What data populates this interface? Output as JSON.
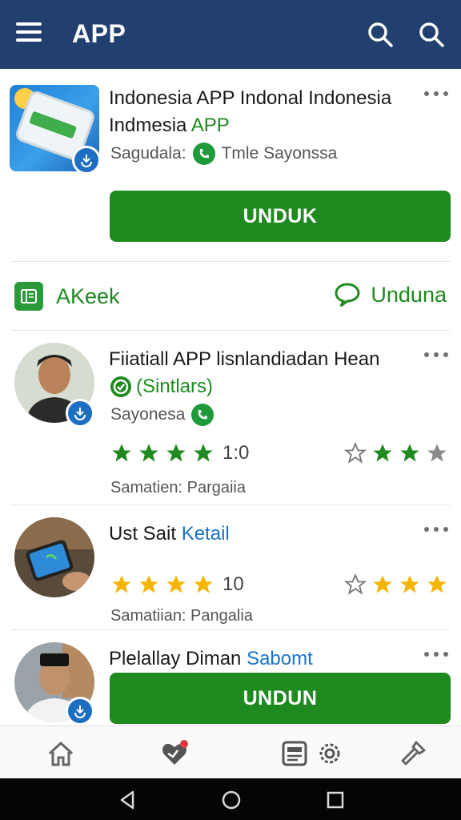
{
  "appbar": {
    "title": "APP",
    "menu_icon": "menu-icon",
    "search_icons": [
      "search-icon",
      "search-icon"
    ]
  },
  "featured": {
    "title_part1": "Indonesia APP Indonal Indonesia",
    "title_part2a": "Indmesia ",
    "title_part2b": "APP",
    "sub_label": "Sagudala:",
    "sub_value": "Tmle Sayonssa",
    "button_label": "UNDUK"
  },
  "section": {
    "left_label": "AKeek",
    "right_label": "Unduna"
  },
  "items": [
    {
      "title": "Fiiatiall APP lisnlandiadan Hean",
      "tag": "(Sintlars)",
      "sub": "Sayonesa",
      "rating_value": "1:0",
      "meta": "Samatien: Pargaiia"
    },
    {
      "title_a": "Ust Sait ",
      "title_b": "Ketail",
      "rating_value": "10",
      "meta": "Samatiian: Pangalia"
    },
    {
      "title_a": "Plelallay Diman ",
      "title_b": "Sabomt",
      "button_label": "UNDUN"
    }
  ],
  "colors": {
    "appbar": "#22406f",
    "accent_green": "#1f8a1f",
    "link_blue": "#1a73c4",
    "star_green": "#1f8a1f",
    "star_gold": "#f5b400"
  },
  "bottom_nav": [
    "home-icon",
    "heart-notification-icon",
    "news-icon",
    "settings-icon",
    "flashlight-icon"
  ],
  "system_nav": [
    "back-icon",
    "home-circle-icon",
    "recents-icon"
  ]
}
